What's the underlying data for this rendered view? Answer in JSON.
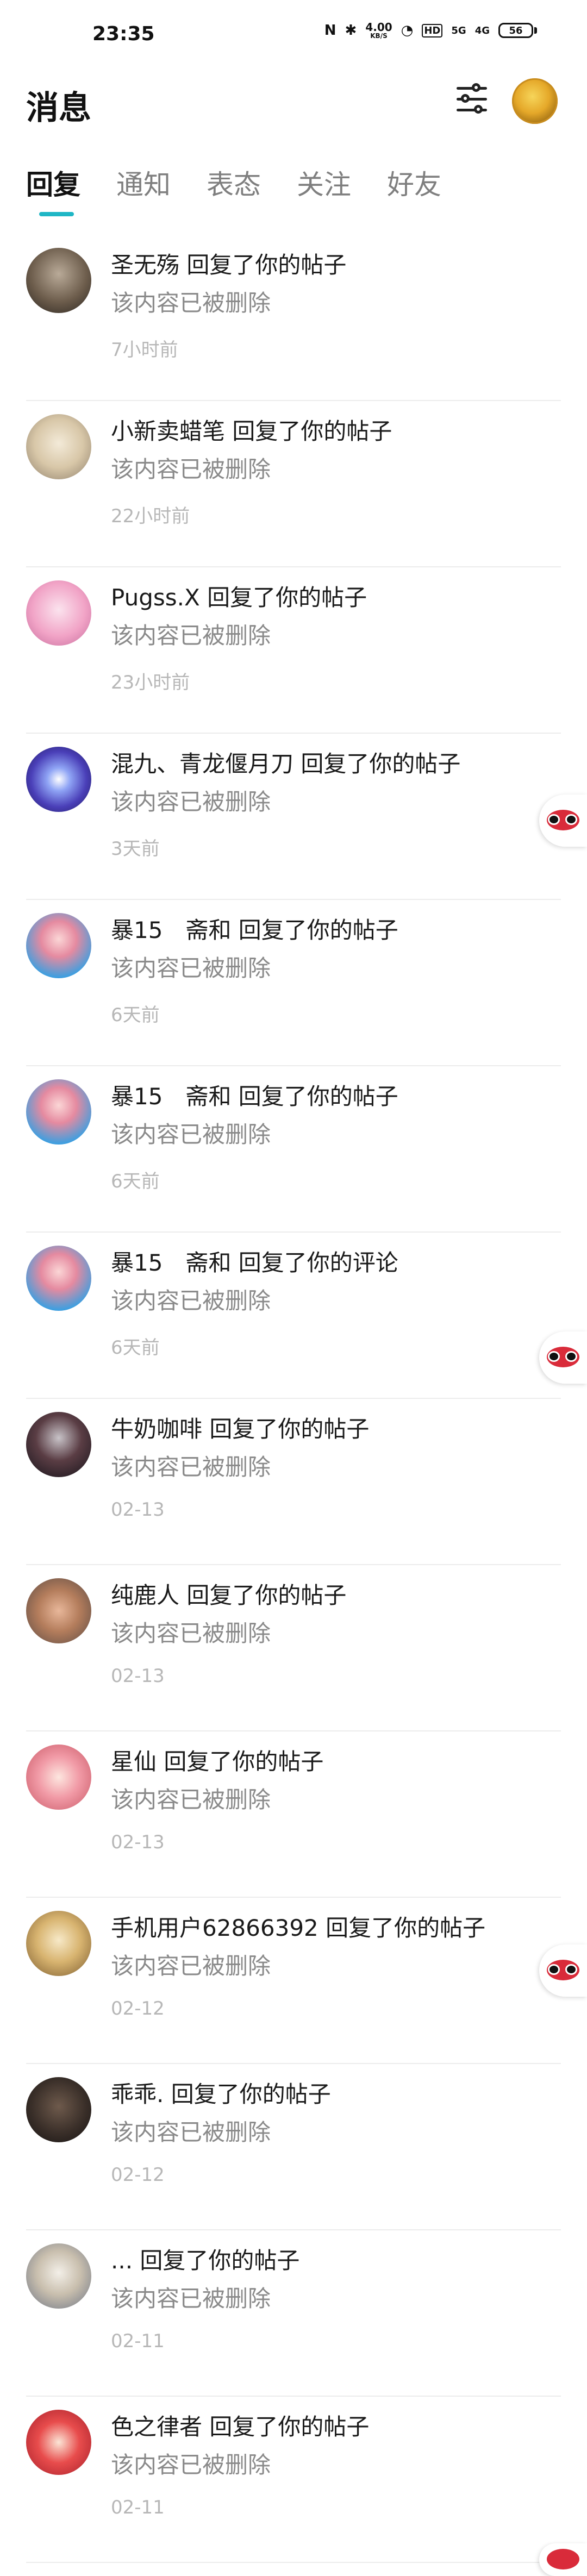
{
  "status_bar": {
    "time": "23:35",
    "nfc": "N",
    "bluetooth": "✱",
    "speed_value": "4.00",
    "speed_unit": "KB/S",
    "wifi": "◔",
    "hd": "HD",
    "signal1": "5G",
    "signal2": "4G",
    "battery": "56"
  },
  "header": {
    "title": "消息"
  },
  "tabs": [
    {
      "label": "回复"
    },
    {
      "label": "通知"
    },
    {
      "label": "表态"
    },
    {
      "label": "关注"
    },
    {
      "label": "好友"
    }
  ],
  "messages": [
    {
      "title": "圣无殇 回复了你的帖子",
      "content": "该内容已被删除",
      "time": "7小时前"
    },
    {
      "title": "小新卖蜡笔 回复了你的帖子",
      "content": "该内容已被删除",
      "time": "22小时前"
    },
    {
      "title": "Pugss.X 回复了你的帖子",
      "content": "该内容已被删除",
      "time": "23小时前"
    },
    {
      "title": "混九、青龙偃月刀 回复了你的帖子",
      "content": "该内容已被删除",
      "time": "3天前"
    },
    {
      "title": "暴15　斋和 回复了你的帖子",
      "content": "该内容已被删除",
      "time": "6天前"
    },
    {
      "title": "暴15　斋和 回复了你的帖子",
      "content": "该内容已被删除",
      "time": "6天前"
    },
    {
      "title": "暴15　斋和 回复了你的评论",
      "content": "该内容已被删除",
      "time": "6天前"
    },
    {
      "title": "牛奶咖啡 回复了你的帖子",
      "content": "该内容已被删除",
      "time": "02-13"
    },
    {
      "title": "纯鹿人 回复了你的帖子",
      "content": "该内容已被删除",
      "time": "02-13"
    },
    {
      "title": "星仙 回复了你的帖子",
      "content": "该内容已被删除",
      "time": "02-13"
    },
    {
      "title": "手机用户62866392 回复了你的帖子",
      "content": "该内容已被删除",
      "time": "02-12"
    },
    {
      "title": "乖乖. 回复了你的帖子",
      "content": "该内容已被删除",
      "time": "02-12"
    },
    {
      "title": "... 回复了你的帖子",
      "content": "该内容已被删除",
      "time": "02-11"
    },
    {
      "title": "色之律者 回复了你的帖子",
      "content": "该内容已被删除",
      "time": "02-11"
    }
  ],
  "colors": {
    "accent": "#1fb6c5",
    "content_gray": "#8a8a8a",
    "time_gray": "#b7b7b7"
  },
  "icons": {
    "filter": "filter-icon",
    "floating": "mask-emoji-icon"
  }
}
